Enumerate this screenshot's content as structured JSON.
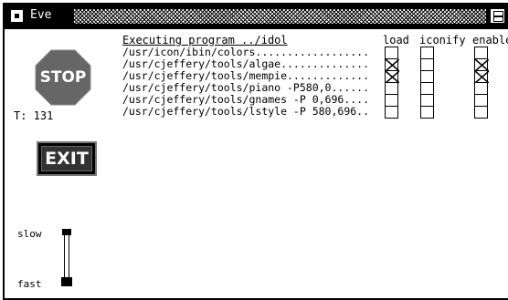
{
  "window": {
    "title": "Eve"
  },
  "stop_button": {
    "label": "STOP",
    "color": "#666666"
  },
  "timer": {
    "label": "T: 131"
  },
  "exit_button": {
    "label": "EXIT"
  },
  "speed": {
    "slow_label": "slow",
    "fast_label": "fast"
  },
  "programs": {
    "header": "Executing program ../idol",
    "columns": {
      "load": "load",
      "iconify": "iconify",
      "enable": "enable"
    },
    "rows": [
      {
        "text": "/usr/icon/ibin/colors..................",
        "load": false,
        "iconify": false,
        "enable": false
      },
      {
        "text": "/usr/cjeffery/tools/algae..............",
        "load": true,
        "iconify": false,
        "enable": true
      },
      {
        "text": "/usr/cjeffery/tools/mempie.............",
        "load": true,
        "iconify": false,
        "enable": true
      },
      {
        "text": "/usr/cjeffery/tools/piano -P580,0......",
        "load": false,
        "iconify": false,
        "enable": false
      },
      {
        "text": "/usr/cjeffery/tools/gnames -P 0,696....",
        "load": false,
        "iconify": false,
        "enable": false
      },
      {
        "text": "/usr/cjeffery/tools/lstyle -P 580,696..",
        "load": false,
        "iconify": false,
        "enable": false
      }
    ]
  }
}
